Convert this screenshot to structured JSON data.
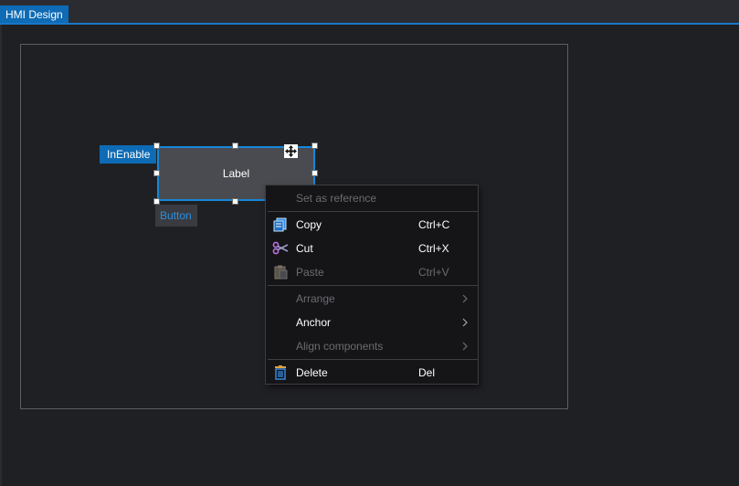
{
  "tab": {
    "label": "HMI Design"
  },
  "component": {
    "label": "Label",
    "enable_badge": "InEnable",
    "type_badge": "Button"
  },
  "context_menu": {
    "items": [
      {
        "label": "Set as reference",
        "shortcut": "",
        "enabled": false,
        "icon": ""
      },
      {
        "label": "Copy",
        "shortcut": "Ctrl+C",
        "enabled": true,
        "icon": "copy-icon"
      },
      {
        "label": "Cut",
        "shortcut": "Ctrl+X",
        "enabled": true,
        "icon": "scissors-icon"
      },
      {
        "label": "Paste",
        "shortcut": "Ctrl+V",
        "enabled": false,
        "icon": "paste-icon"
      },
      {
        "label": "Arrange",
        "shortcut": "",
        "enabled": false,
        "icon": "",
        "submenu": true
      },
      {
        "label": "Anchor",
        "shortcut": "",
        "enabled": true,
        "icon": "",
        "submenu": true
      },
      {
        "label": "Align components",
        "shortcut": "",
        "enabled": false,
        "icon": "",
        "submenu": true
      },
      {
        "label": "Delete",
        "shortcut": "Del",
        "enabled": true,
        "icon": "trash-icon"
      }
    ]
  },
  "colors": {
    "accent": "#0e6bb5",
    "selection_border": "#1687d8",
    "surface": "#1f2024",
    "menu_bg": "#151518"
  }
}
